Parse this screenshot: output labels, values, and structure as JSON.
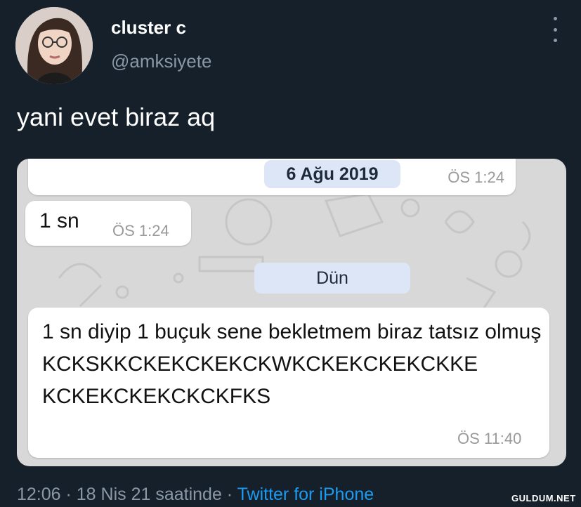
{
  "tweet": {
    "display_name": "cluster c",
    "handle": "@amksiyete",
    "text": "yani evet biraz aq",
    "timestamp": "12:06 · 18 Nis 21 saatinde · ",
    "source": "Twitter for iPhone"
  },
  "chat": {
    "date_label": "6 Ağu 2019",
    "top_time": "ÖS 1:24",
    "msg1_text": "1 sn",
    "msg1_time": "ÖS 1:24",
    "day_label": "Dün",
    "msg2_text": "1 sn diyip 1 buçuk sene bekletmem biraz tatsız olmuş KCKSKKCKEKCKEKCKWKCKEKCKEKCKKE KCKEKCKEKCKCKFKS",
    "msg2_time": "ÖS 11:40"
  },
  "watermark": "GULDUM.NET",
  "colors": {
    "background": "#15202b",
    "secondary_text": "#8b98a5",
    "link": "#1d9bf0",
    "chat_bg": "#d8d8d8",
    "pill": "#dde6f7"
  },
  "icons": [
    "more-vertical-icon"
  ]
}
